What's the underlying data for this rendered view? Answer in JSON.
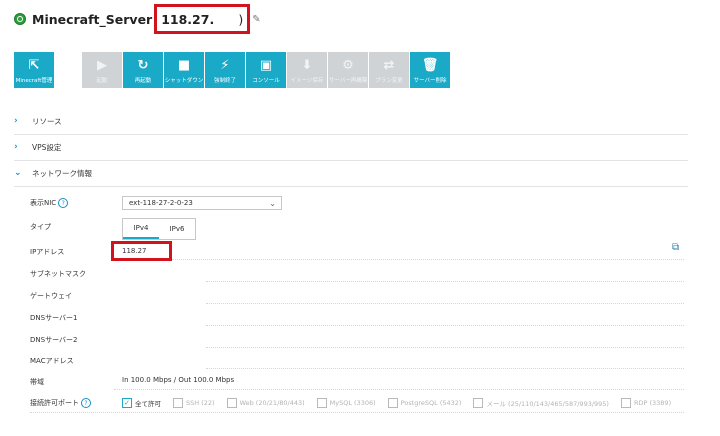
{
  "header": {
    "server_name": "Minecraft_Server",
    "ip_prefix": "118.27.",
    "ip_suffix": ")",
    "edit_glyph": "✎"
  },
  "toolbar": [
    {
      "label": "Minecraft管理",
      "icon": "external-link-icon",
      "glyph": "⇱",
      "state": "on"
    },
    {
      "label": "起動",
      "icon": "play-icon",
      "glyph": "▶",
      "state": "off"
    },
    {
      "label": "再起動",
      "icon": "restart-icon",
      "glyph": "↻",
      "state": "on"
    },
    {
      "label": "シャットダウン",
      "icon": "stop-icon",
      "glyph": "■",
      "state": "on"
    },
    {
      "label": "強制終了",
      "icon": "plug-icon",
      "glyph": "⚡",
      "state": "on"
    },
    {
      "label": "コンソール",
      "icon": "console-icon",
      "glyph": "▣",
      "state": "on"
    },
    {
      "label": "イメージ保存",
      "icon": "image-save-icon",
      "glyph": "⬇",
      "state": "off"
    },
    {
      "label": "サーバー再構築",
      "icon": "rebuild-icon",
      "glyph": "⚙",
      "state": "off"
    },
    {
      "label": "プラン変更",
      "icon": "swap-icon",
      "glyph": "⇄",
      "state": "off"
    },
    {
      "label": "サーバー削除",
      "icon": "trash-icon",
      "glyph": "🗑",
      "state": "on"
    }
  ],
  "sections": [
    {
      "label": "リソース",
      "chev": "›"
    },
    {
      "label": "VPS設定",
      "chev": "›"
    },
    {
      "label": "ネットワーク情報",
      "chev": "⌄"
    }
  ],
  "network": {
    "nic_label": "表示NIC",
    "nic_value": "ext-118-27-2-0-23",
    "type_label": "タイプ",
    "tab_ipv4": "IPv4",
    "tab_ipv6": "IPv6",
    "ip_label": "IPアドレス",
    "ip_value": "118.27",
    "subnet_label": "サブネットマスク",
    "gateway_label": "ゲートウェイ",
    "dns1_label": "DNSサーバー1",
    "dns2_label": "DNSサーバー2",
    "mac_label": "MACアドレス",
    "bandwidth_label": "帯域",
    "bandwidth_value": "In 100.0 Mbps / Out 100.0 Mbps",
    "ports_label": "接続許可ポート",
    "ports": [
      {
        "label": "全て許可",
        "checked": true
      },
      {
        "label": "SSH (22)",
        "checked": false
      },
      {
        "label": "Web (20/21/80/443)",
        "checked": false
      },
      {
        "label": "MySQL (3306)",
        "checked": false
      },
      {
        "label": "PostgreSQL (5432)",
        "checked": false
      },
      {
        "label": "メール (25/110/143/465/587/993/995)",
        "checked": false
      },
      {
        "label": "RDP (3389)",
        "checked": false
      }
    ]
  }
}
